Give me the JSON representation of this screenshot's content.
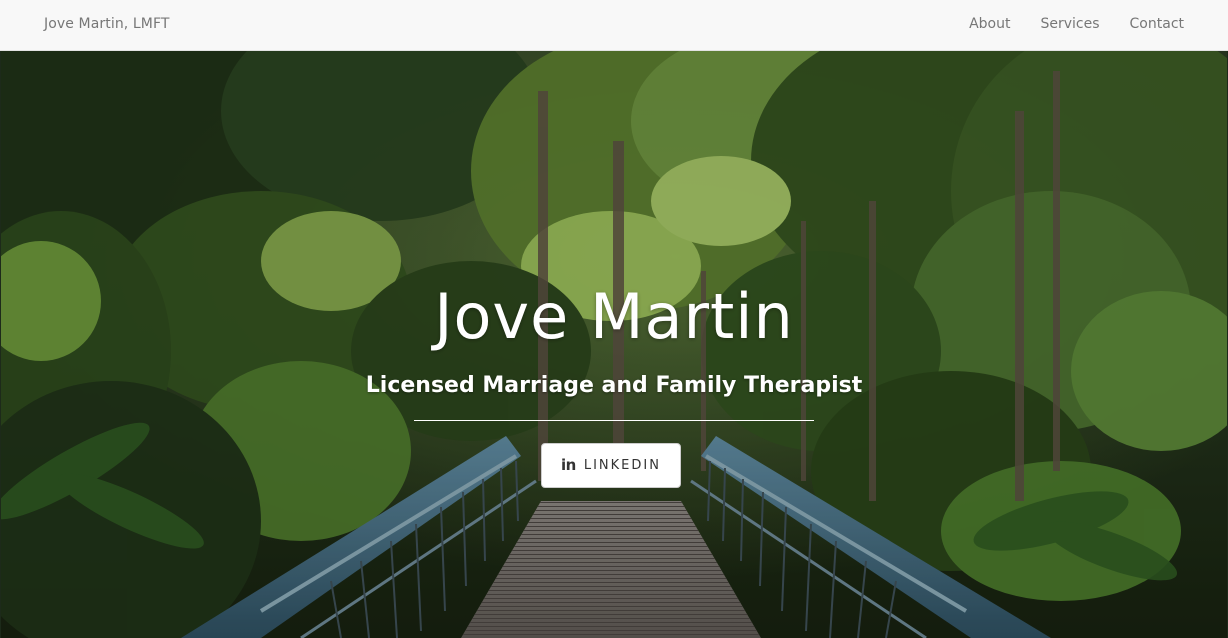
{
  "navbar": {
    "brand": "Jove Martin, LMFT",
    "links": [
      {
        "label": "About"
      },
      {
        "label": "Services"
      },
      {
        "label": "Contact"
      }
    ]
  },
  "hero": {
    "title": "Jove Martin",
    "subtitle": "Licensed Marriage and Family Therapist",
    "linkedin_button": {
      "icon": "linkedin-icon",
      "icon_glyph": "in",
      "label": "LINKEDIN"
    }
  },
  "colors": {
    "navbar_bg": "#f8f8f8",
    "nav_text": "#777777",
    "hero_text": "#ffffff",
    "button_bg": "#ffffff",
    "button_text": "#333333"
  }
}
